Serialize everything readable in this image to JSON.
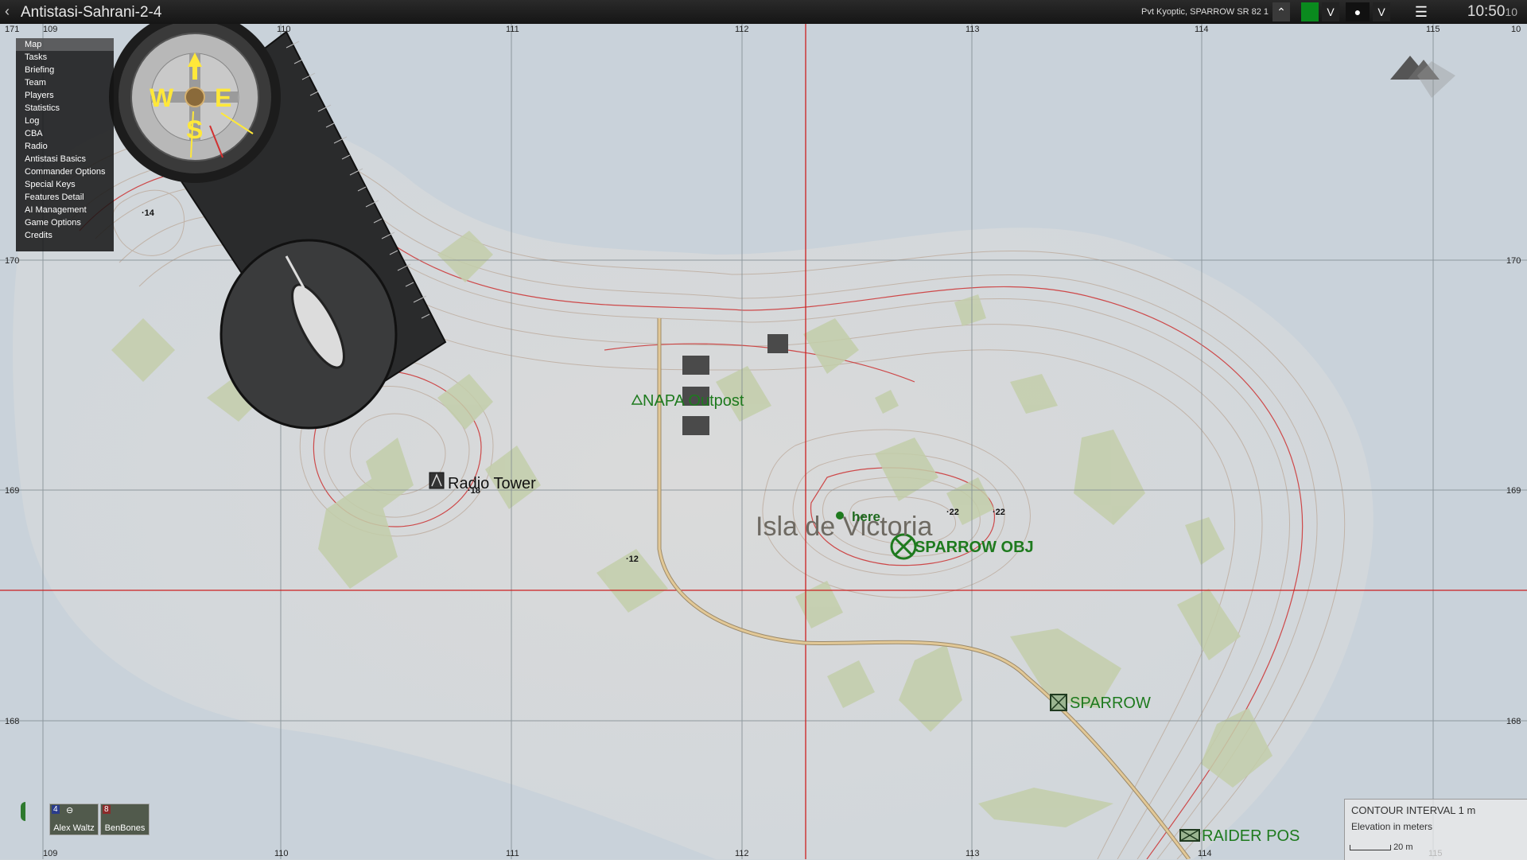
{
  "window": {
    "title": "Antistasi-Sahrani-2-4"
  },
  "topbar": {
    "player_info": "Pvt Kyoptic, SPARROW SR 82 1",
    "clock": "10:50",
    "clock_seconds": "10",
    "color_active": "#0a8a1e"
  },
  "menu": {
    "items": [
      "Map",
      "Tasks",
      "Briefing",
      "Team",
      "Players",
      "Statistics",
      "Log",
      "CBA",
      "Radio",
      "Antistasi Basics",
      "Commander Options",
      "Special Keys",
      "Features Detail",
      "AI Management",
      "Game Options",
      "Credits"
    ],
    "selected": "Map"
  },
  "compass": {
    "labels": [
      "W",
      "E",
      "S"
    ]
  },
  "grid": {
    "top": [
      "171",
      "109",
      "110",
      "111",
      "112",
      "113",
      "114",
      "115",
      "10"
    ],
    "left": [
      "170",
      "169",
      "168"
    ],
    "right": [
      "170",
      "169",
      "168"
    ],
    "bottom": [
      "109",
      "110",
      "111",
      "112",
      "113",
      "114",
      "115"
    ]
  },
  "map_labels": {
    "island": "Isla de Victoria",
    "napa": "NAPA Outpost",
    "radio_tower": "Radio Tower",
    "here": "here",
    "sparrow_obj": "SPARROW OBJ",
    "sparrow": "SPARROW",
    "raider": "RAIDER POS",
    "heights": [
      "14",
      "12",
      "22",
      "22",
      "18"
    ]
  },
  "legend": {
    "contour": "CONTOUR INTERVAL 1 m",
    "elevation": "Elevation in meters",
    "scale": "20 m"
  },
  "squad": {
    "members": [
      {
        "name": "Alex Waltz",
        "badge": "4"
      },
      {
        "name": "BenBones",
        "badge": "8"
      }
    ]
  },
  "colors": {
    "map_bg": "#cdd4da",
    "land": "#d9d9d9",
    "forest": "#c6d0a8",
    "marker_green": "#1e7a1e",
    "road": "#e2c896",
    "gridline_red": "#cc2020"
  }
}
